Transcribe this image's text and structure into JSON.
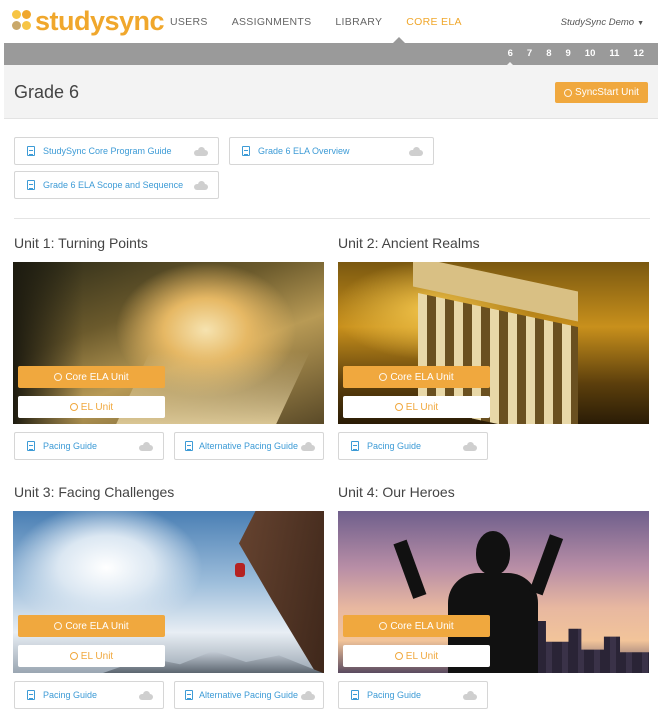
{
  "app": {
    "logo_text": "studysync",
    "brand_color": "#f0a72c",
    "link_color": "#3d9bd6"
  },
  "nav": {
    "items": [
      {
        "label": "USERS",
        "active": false
      },
      {
        "label": "ASSIGNMENTS",
        "active": false
      },
      {
        "label": "LIBRARY",
        "active": false
      },
      {
        "label": "CORE ELA",
        "active": true
      }
    ],
    "user": "StudySync Demo"
  },
  "grades": [
    "6",
    "7",
    "8",
    "9",
    "10",
    "11",
    "12"
  ],
  "active_grade": "6",
  "header": {
    "title": "Grade 6",
    "syncstart_label": "SyncStart Unit"
  },
  "documents": [
    {
      "label": "StudySync Core Program Guide",
      "icon": "pdf-icon"
    },
    {
      "label": "Grade 6 ELA Overview",
      "icon": "pdf-icon"
    },
    {
      "label": "Grade 6 ELA Scope and Sequence",
      "icon": "pdf-icon"
    }
  ],
  "units": [
    {
      "title": "Unit 1: Turning Points",
      "image": "forest path with sunlight",
      "core_label": "Core ELA Unit",
      "el_label": "EL Unit",
      "links": [
        {
          "label": "Pacing Guide"
        },
        {
          "label": "Alternative Pacing Guide"
        }
      ]
    },
    {
      "title": "Unit 2: Ancient Realms",
      "image": "greek temple at sunset",
      "core_label": "Core ELA Unit",
      "el_label": "EL Unit",
      "links": [
        {
          "label": "Pacing Guide"
        }
      ]
    },
    {
      "title": "Unit 3: Facing Challenges",
      "image": "rock climber on cliff",
      "core_label": "Core ELA Unit",
      "el_label": "EL Unit",
      "links": [
        {
          "label": "Pacing Guide"
        },
        {
          "label": "Alternative Pacing Guide"
        }
      ]
    },
    {
      "title": "Unit 4: Our Heroes",
      "image": "silhouette with raised arms over city",
      "core_label": "Core ELA Unit",
      "el_label": "EL Unit",
      "links": [
        {
          "label": "Pacing Guide"
        }
      ]
    }
  ]
}
